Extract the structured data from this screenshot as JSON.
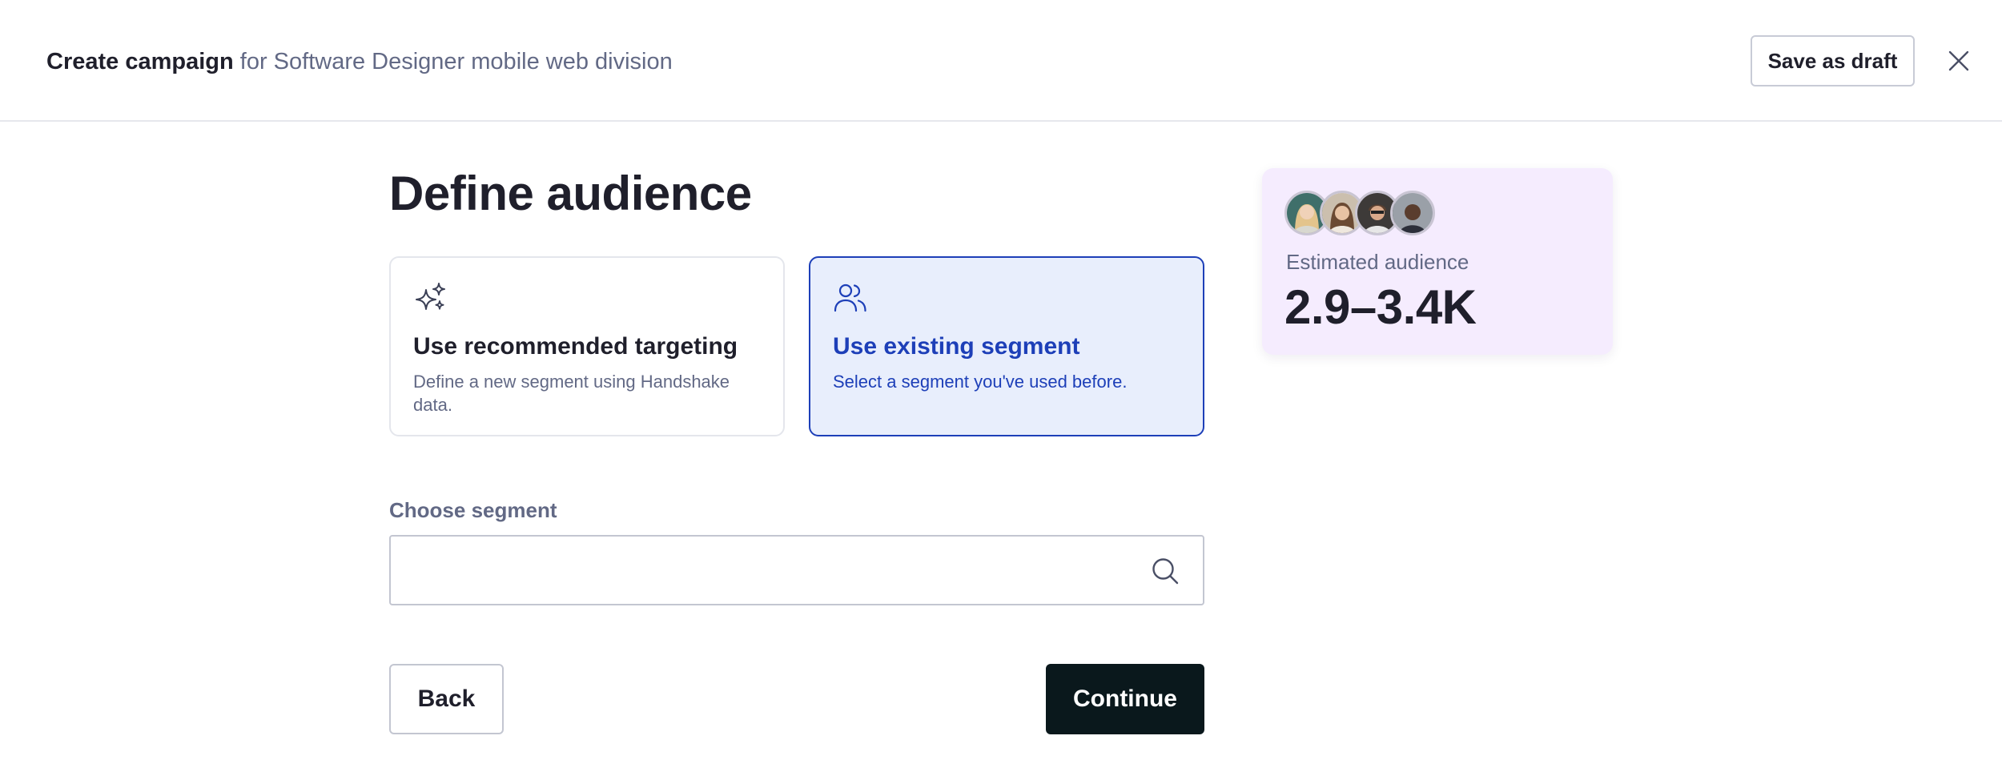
{
  "header": {
    "title_strong": "Create campaign",
    "title_rest": " for Software Designer mobile web division",
    "save_draft_label": "Save as draft"
  },
  "main": {
    "title": "Define audience",
    "options": [
      {
        "title": "Use recommended targeting",
        "description": "Define a new segment using Handshake data.",
        "icon": "sparkles-icon",
        "selected": false
      },
      {
        "title": "Use existing segment",
        "description": "Select a segment you've used before.",
        "icon": "users-icon",
        "selected": true
      }
    ],
    "segment": {
      "label": "Choose segment",
      "value": "",
      "placeholder": ""
    },
    "back_label": "Back",
    "continue_label": "Continue"
  },
  "estimate": {
    "label": "Estimated audience",
    "value": "2.9–3.4K"
  },
  "colors": {
    "accent": "#1d3fb8",
    "selected_bg": "#e8eefc",
    "estimate_bg": "#f5ecfe",
    "primary_button": "#0a181c"
  }
}
